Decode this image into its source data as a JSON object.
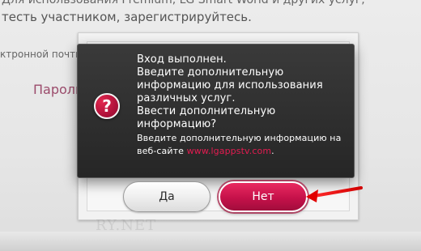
{
  "background_page": {
    "line1": "Для использования Premium, LG Smart World и других услуг,",
    "line2": "тесть участником, зарегистрируйтесь.",
    "email_label": "ктронной почты",
    "password_label": "Пароль",
    "watermark": "RY.NET"
  },
  "dialog": {
    "icon": "question-icon",
    "message_lines": [
      "Вход выполнен.",
      "Введите дополнительную",
      "информацию для использования",
      "различных услуг.",
      "Ввести дополнительную",
      "информацию?"
    ],
    "note_line1": "Введите дополнительную информацию на",
    "note_prefix": "веб-сайте ",
    "note_link": "www.lgappstv.com",
    "note_suffix": ".",
    "colors": {
      "link": "#e31b50",
      "accent": "#c5114a"
    }
  },
  "buttons": {
    "yes_label": "Да",
    "no_label": "Нет"
  }
}
